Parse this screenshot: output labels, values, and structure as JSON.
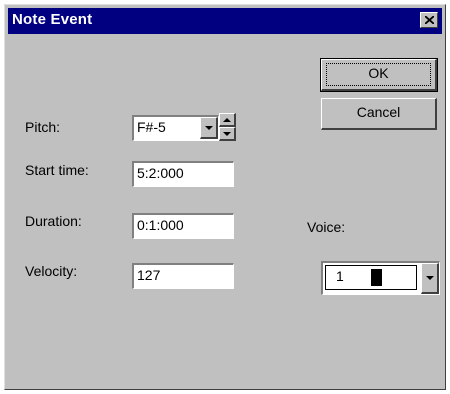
{
  "window": {
    "title": "Note Event",
    "close_icon": "close-x-icon"
  },
  "buttons": {
    "ok_label": "OK",
    "cancel_label": "Cancel"
  },
  "fields": {
    "pitch": {
      "label": "Pitch:",
      "value": "F#-5"
    },
    "start_time": {
      "label": "Start time:",
      "value": "5:2:000"
    },
    "duration": {
      "label": "Duration:",
      "value": "0:1:000"
    },
    "velocity": {
      "label": "Velocity:",
      "value": "127"
    },
    "voice": {
      "label": "Voice:",
      "value": "1",
      "swatch_color": "#000000"
    }
  },
  "colors": {
    "title_bar": "#000080",
    "face": "#c0c0c0"
  }
}
